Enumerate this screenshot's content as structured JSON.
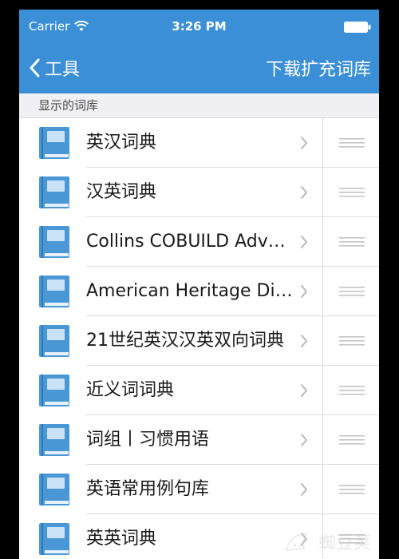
{
  "status_bar": {
    "carrier": "Carrier",
    "wifi_icon": "wifi-icon",
    "time": "3:26 PM",
    "battery_icon": "battery-icon"
  },
  "nav": {
    "back_label": "工具",
    "back_icon": "chevron-left-icon",
    "action_label": "下载扩充词库"
  },
  "section": {
    "title": "显示的词库"
  },
  "list": {
    "items": [
      {
        "label": "英汉词典"
      },
      {
        "label": "汉英词典"
      },
      {
        "label": "Collins COBUILD Advanced Dictionary"
      },
      {
        "label": "American Heritage Dictionary"
      },
      {
        "label": "21世纪英汉汉英双向词典"
      },
      {
        "label": "近义词词典"
      },
      {
        "label": "词组丨习惯用语"
      },
      {
        "label": "英语常用例句库"
      },
      {
        "label": "英英词典"
      }
    ],
    "item_icon": "book-icon",
    "disclosure_icon": "chevron-right-icon",
    "reorder_icon": "reorder-icon"
  },
  "watermark": {
    "text": "蜘豆荚"
  },
  "colors": {
    "accent": "#3b8fd6",
    "section_bg": "#efeff4",
    "divider": "#dcdcdc",
    "book_blue": "#4a97d6"
  }
}
